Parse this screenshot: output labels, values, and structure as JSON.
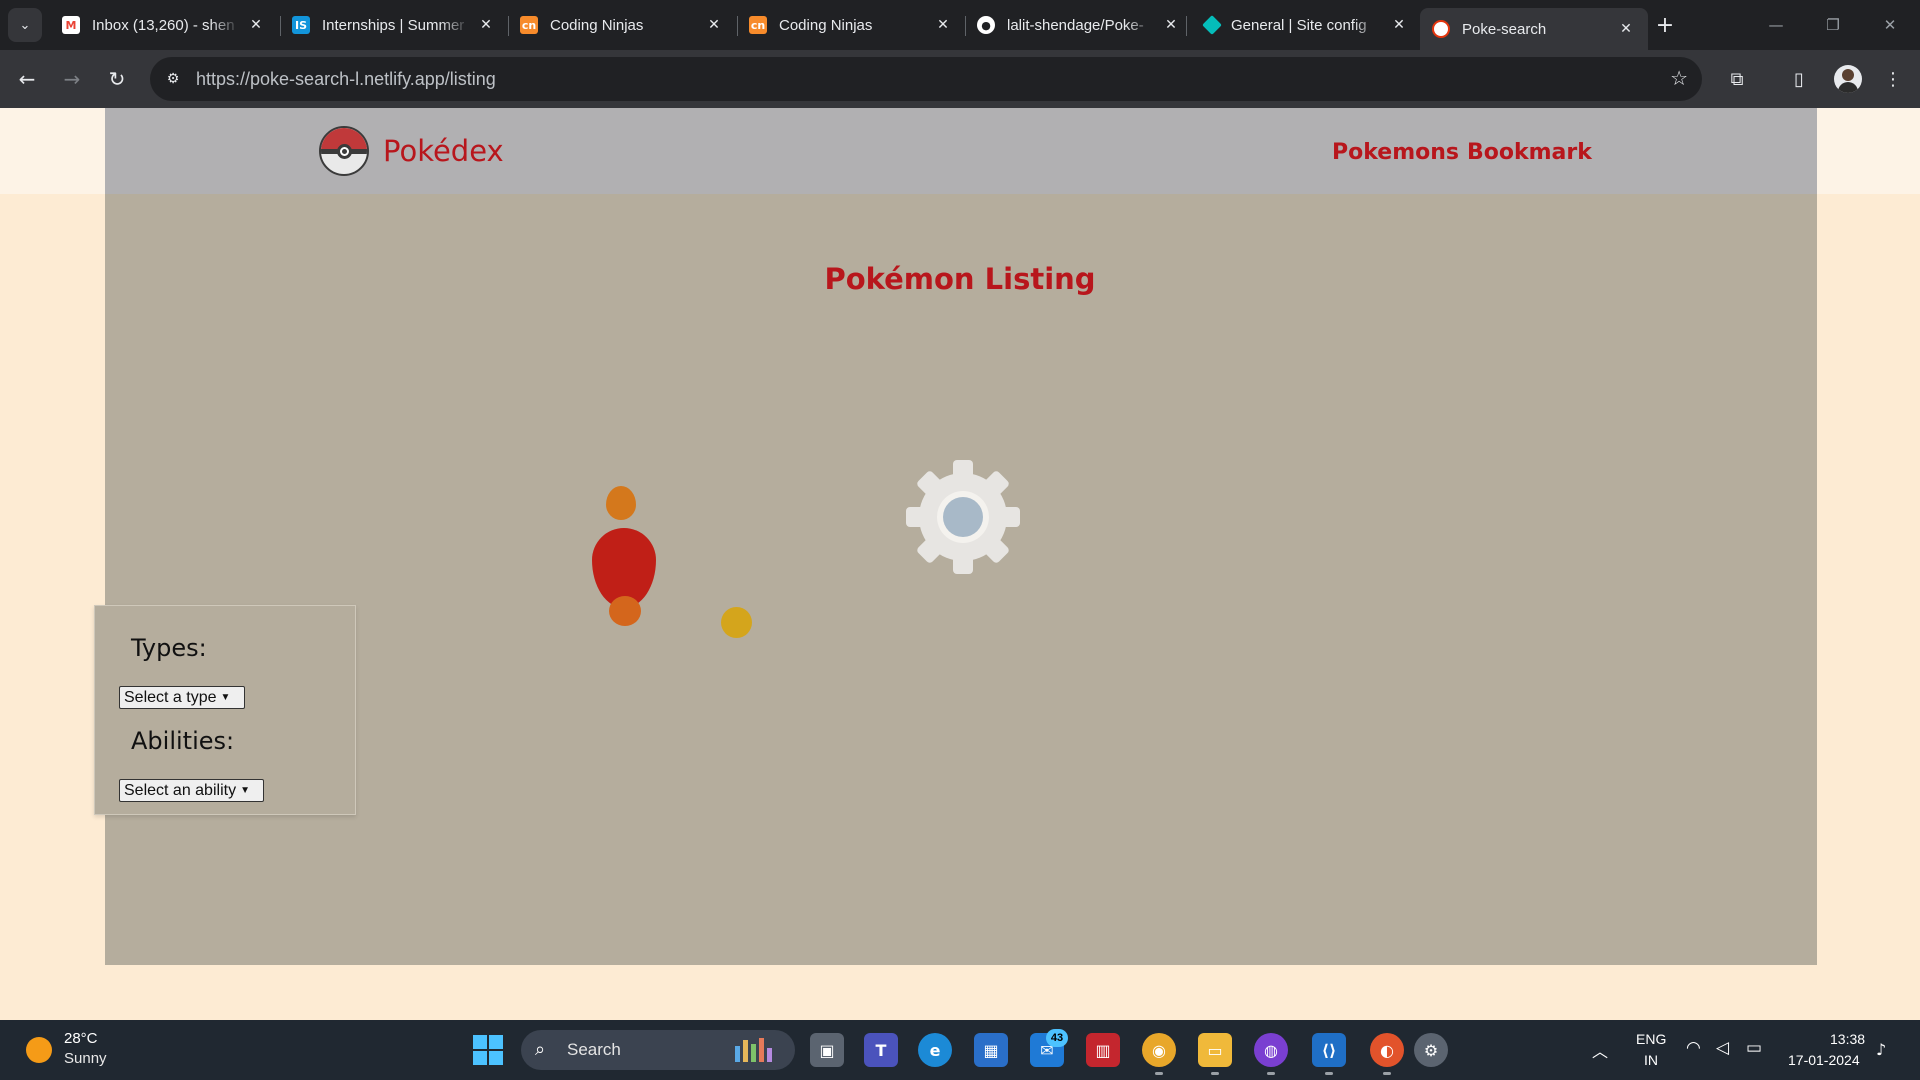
{
  "browser": {
    "tabs": [
      {
        "title": "Inbox (13,260) - shen",
        "favicon": "gmail-icon",
        "favicon_color": "#ea4335"
      },
      {
        "title": "Internships | Summer",
        "favicon": "internshala-icon",
        "favicon_color": "#1295db"
      },
      {
        "title": "Coding Ninjas",
        "favicon": "coding-ninjas-icon",
        "favicon_color": "#f78b2b"
      },
      {
        "title": "Coding Ninjas",
        "favicon": "coding-ninjas-icon",
        "favicon_color": "#f78b2b"
      },
      {
        "title": "lalit-shendage/Poke-",
        "favicon": "github-icon",
        "favicon_color": "#ffffff"
      },
      {
        "title": "General | Site config",
        "favicon": "netlify-icon",
        "favicon_color": "#05bdba"
      },
      {
        "title": "Poke-search",
        "favicon": "pokeball-icon",
        "favicon_color": "#e3350d",
        "active": true
      }
    ],
    "url": "https://poke-search-l.netlify.app/listing"
  },
  "page": {
    "brand": "Pokédex",
    "nav": {
      "pokemons": "Pokemons",
      "bookmark": "Bookmark"
    },
    "title": "Pokémon Listing",
    "filters": {
      "types_label": "Types:",
      "types_selected": "Select a type",
      "abilities_label": "Abilities:",
      "abilities_selected": "Select an ability"
    },
    "colors": {
      "accent": "#b8161c",
      "header_bg": "#b1b0b2",
      "content_bg": "#b5ad9d",
      "page_bg": "#fdebd3"
    }
  },
  "taskbar": {
    "weather": {
      "temp": "28°C",
      "condition": "Sunny"
    },
    "search_label": "Search",
    "mail_badge": "43",
    "language": {
      "line1": "ENG",
      "line2": "IN"
    },
    "clock": {
      "time": "13:38",
      "date": "17-01-2024"
    }
  }
}
